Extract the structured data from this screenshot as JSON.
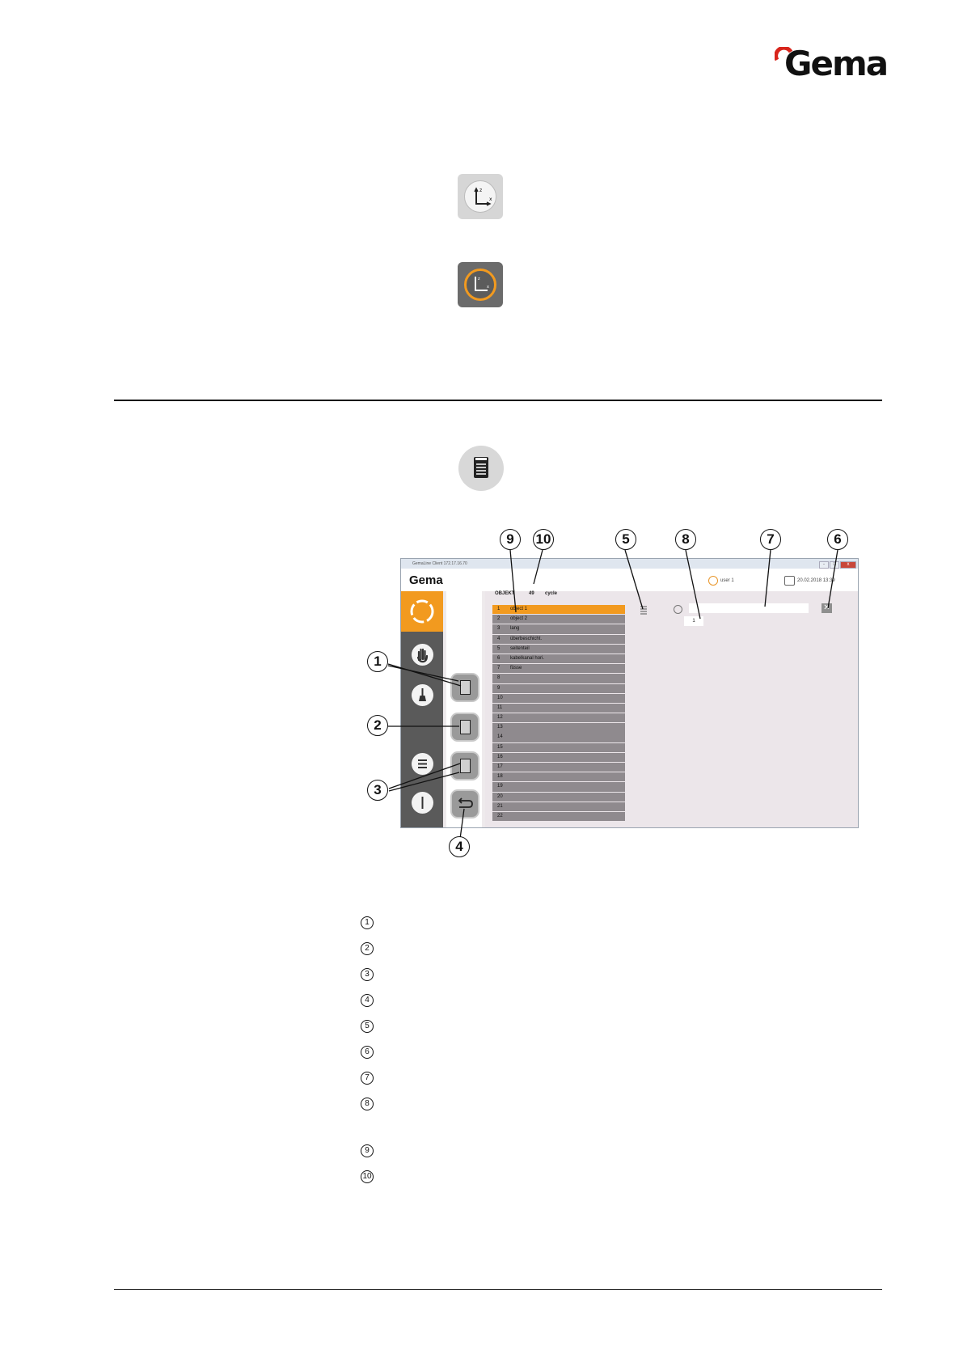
{
  "logo": {
    "text": "Gema"
  },
  "screenshot": {
    "window_title": "GemaLine Client 172.17.16.70",
    "app_logo": "Gema",
    "user": "user 1",
    "datetime": "20.02.2018 13:39",
    "object_label": "OBJEKT",
    "object_count": "49",
    "cycle_label": "cycle",
    "objects": [
      {
        "n": "1",
        "name": "object 1",
        "selected": true
      },
      {
        "n": "2",
        "name": "object 2"
      },
      {
        "n": "3",
        "name": "lang"
      },
      {
        "n": "4",
        "name": "überbeschicht."
      },
      {
        "n": "5",
        "name": "seitenteil"
      },
      {
        "n": "6",
        "name": "kabelkanal hori."
      },
      {
        "n": "7",
        "name": "füsse"
      },
      {
        "n": "8",
        "name": ""
      },
      {
        "n": "9",
        "name": ""
      },
      {
        "n": "10",
        "name": ""
      },
      {
        "n": "11",
        "name": ""
      },
      {
        "n": "12",
        "name": ""
      },
      {
        "n": "13",
        "name": ""
      },
      {
        "n": "14",
        "name": ""
      },
      {
        "n": "15",
        "name": ""
      },
      {
        "n": "16",
        "name": ""
      },
      {
        "n": "17",
        "name": ""
      },
      {
        "n": "18",
        "name": ""
      },
      {
        "n": "19",
        "name": ""
      },
      {
        "n": "20",
        "name": ""
      },
      {
        "n": "21",
        "name": ""
      },
      {
        "n": "22",
        "name": ""
      }
    ],
    "object_number_value": "1",
    "delete_symbol": "✕"
  },
  "callouts": [
    "1",
    "2",
    "3",
    "4",
    "5",
    "6",
    "7",
    "8",
    "9",
    "10"
  ],
  "legend": [
    "1",
    "2",
    "3",
    "4",
    "5",
    "6",
    "7",
    "8",
    "9",
    "10"
  ]
}
